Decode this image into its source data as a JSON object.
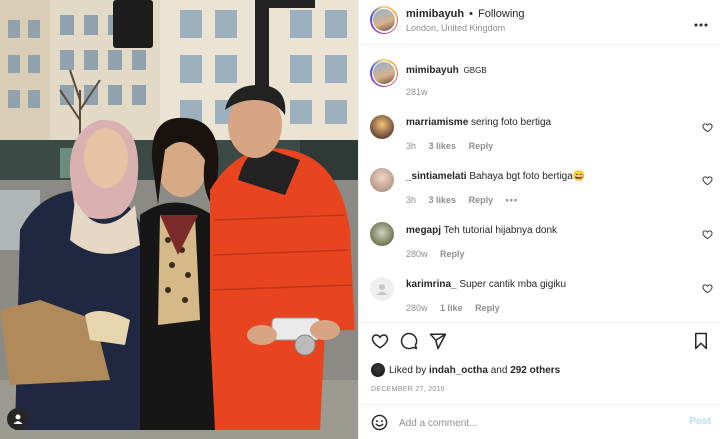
{
  "post": {
    "author": "mimibayuh",
    "separator": "•",
    "follow_status": "Following",
    "location": "London, United Kingdom",
    "more_icon": "more-horizontal-icon"
  },
  "caption": {
    "username": "mimibayuh",
    "text": "GBGB",
    "time": "281w"
  },
  "comments": [
    {
      "username": "marriamisme",
      "text": "sering foto bertiga",
      "time": "3h",
      "likes": "3 likes",
      "reply": "Reply",
      "more": ""
    },
    {
      "username": "_sintiamelati",
      "text": "Bahaya bgt foto bertiga😄",
      "time": "3h",
      "likes": "3 likes",
      "reply": "Reply",
      "more": "•••"
    },
    {
      "username": "megapj",
      "text": "Teh tutorial hijabnya donk",
      "time": "280w",
      "likes": "",
      "reply": "Reply",
      "more": ""
    },
    {
      "username": "karimrina_",
      "text": "Super cantik mba gigiku",
      "time": "280w",
      "likes": "1 like",
      "reply": "Reply",
      "more": ""
    }
  ],
  "actions": {
    "icons": [
      "heart-icon",
      "comment-icon",
      "share-icon",
      "bookmark-icon"
    ],
    "liked_by_prefix": "Liked by",
    "liked_by_user": "indah_octha",
    "liked_by_and": "and",
    "liked_by_others": "292 others",
    "date": "DECEMBER 27, 2016"
  },
  "comment_box": {
    "placeholder": "Add a comment...",
    "post_label": "Post",
    "emoji_icon": "emoji-icon"
  },
  "colors": {
    "jacket_red": "#e8441f",
    "link_blue": "#b2dffc",
    "muted_text": "#8e8e8e"
  }
}
